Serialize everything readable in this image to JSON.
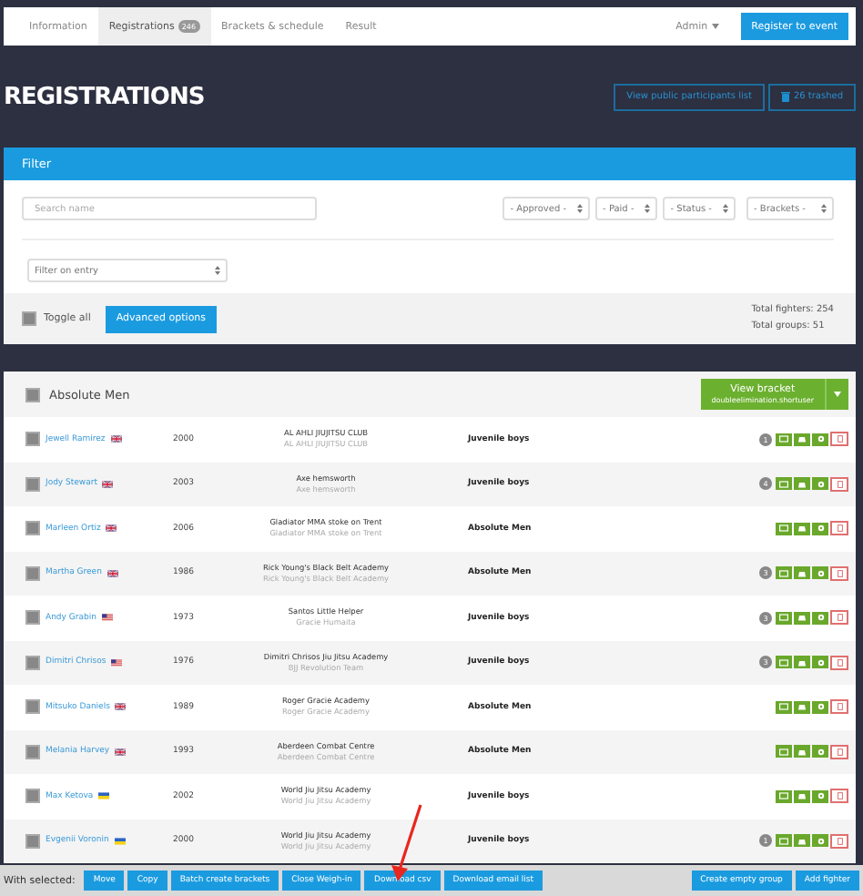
{
  "nav": {
    "tabs": [
      {
        "label": "Information",
        "selected": false
      },
      {
        "label": "Registrations",
        "count": "246",
        "selected": true
      },
      {
        "label": "Brackets & schedule",
        "selected": false
      },
      {
        "label": "Result",
        "selected": false
      }
    ],
    "user": "Admin",
    "cta": "Register to event"
  },
  "heading": "REGISTRATIONS",
  "header_buttons": {
    "public_list": "View public participants list",
    "trashed": "26 trashed"
  },
  "filter": {
    "title": "Filter",
    "search": {
      "placeholder": "Search name"
    },
    "selects": [
      "- Approved -",
      "- Paid -",
      "- Status -",
      "- Brackets -"
    ],
    "entry_select": "Filter on entry",
    "toggle_all": {
      "label": "Toggle all",
      "checked": false
    },
    "advanced": "Advanced options",
    "totals": [
      "Total fighters: 254",
      "Total groups: 51"
    ]
  },
  "group": {
    "title": "Absolute Men",
    "checked": false,
    "view_bracket": "View bracket",
    "bracket_type": "doubleelimination.shortuser",
    "rows": [
      {
        "name": "Jewell Ramirez",
        "checked": false,
        "flag": {
          "kind": "uk"
        },
        "year": "2000",
        "club": "AL AHLI JIUJITSU CLUB",
        "team": "AL AHLI JIUJITSU CLUB",
        "category": "Juvenile boys",
        "badge": "1"
      },
      {
        "name": "Jody Stewart",
        "checked": false,
        "flag": {
          "kind": "uk"
        },
        "year": "2003",
        "club": "Axe hemsworth",
        "team": "Axe hemsworth",
        "category": "Juvenile boys",
        "badge": "4"
      },
      {
        "name": "Marleen Ortiz",
        "checked": false,
        "flag": {
          "kind": "uk"
        },
        "year": "2006",
        "club": "Gladiator MMA stoke on Trent",
        "team": "Gladiator MMA stoke on Trent",
        "category": "Absolute Men"
      },
      {
        "name": "Martha Green",
        "checked": false,
        "flag": {
          "kind": "uk"
        },
        "year": "1986",
        "club": "Rick Young's Black Belt Academy",
        "team": "Rick Young's Black Belt Academy",
        "category": "Absolute Men",
        "badge": "3"
      },
      {
        "name": "Andy Grabin",
        "checked": false,
        "flag": {
          "kind": "us"
        },
        "year": "1973",
        "club": "Santos Little Helper",
        "team": "Gracie Humaita",
        "category": "Juvenile boys",
        "badge": "3"
      },
      {
        "name": "Dimitri Chrisos",
        "checked": false,
        "flag": {
          "kind": "us"
        },
        "year": "1976",
        "club": "Dimitri Chrisos Jiu Jitsu Academy",
        "team": "BJJ Revolution Team",
        "category": "Juvenile boys",
        "badge": "3"
      },
      {
        "name": "Mitsuko Daniels",
        "checked": false,
        "flag": {
          "kind": "uk"
        },
        "year": "1989",
        "club": "Roger Gracie Academy",
        "team": "Roger Gracie Academy",
        "category": "Absolute Men"
      },
      {
        "name": "Melania Harvey",
        "checked": false,
        "flag": {
          "kind": "uk"
        },
        "year": "1993",
        "club": "Aberdeen Combat Centre",
        "team": "Aberdeen Combat Centre",
        "category": "Absolute Men"
      },
      {
        "name": "Max Ketova",
        "checked": false,
        "flag": {
          "kind": "ua"
        },
        "year": "2002",
        "club": "World Jiu Jitsu Academy",
        "team": "World Jiu Jitsu Academy",
        "category": "Juvenile boys"
      },
      {
        "name": "Evgenii Voronin",
        "checked": false,
        "flag": {
          "kind": "ua"
        },
        "year": "2000",
        "club": "World Jiu Jitsu Academy",
        "team": "World Jiu Jitsu Academy",
        "category": "Juvenile boys",
        "badge": "1"
      }
    ]
  },
  "bottom_bar": {
    "label": "With selected:",
    "actions": [
      "Move",
      "Copy",
      "Batch create brackets",
      "Close Weigh-in",
      "Download csv",
      "Download email list"
    ],
    "right_actions": [
      "Create empty group",
      "Add fighter"
    ]
  }
}
